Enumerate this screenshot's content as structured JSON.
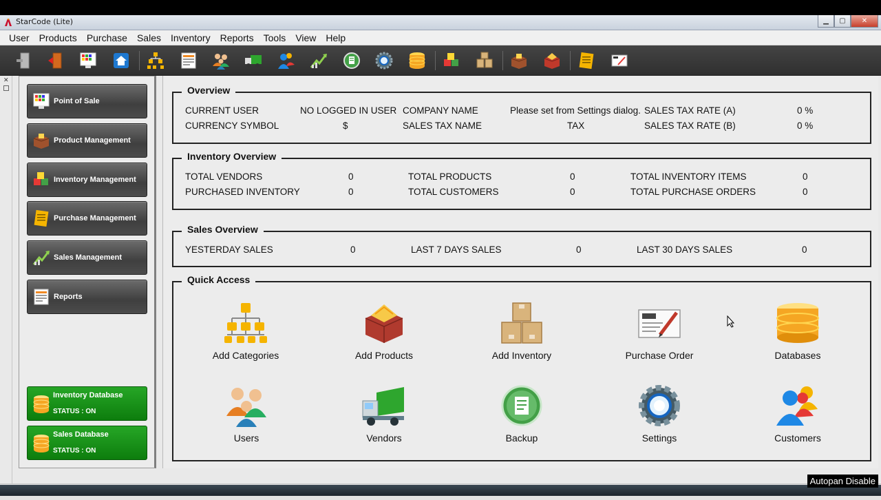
{
  "window": {
    "title": "StarCode (Lite)"
  },
  "menu": [
    "User",
    "Products",
    "Purchase",
    "Sales",
    "Inventory",
    "Reports",
    "Tools",
    "View",
    "Help"
  ],
  "toolbar_icons": [
    "logout-icon",
    "exit-icon",
    "pos-icon",
    "home-icon",
    "categories-icon",
    "reports-icon",
    "users-icon",
    "vendors-icon",
    "customers-icon",
    "sales-icon",
    "backup-icon",
    "settings-icon",
    "database-icon",
    "inventory-icon",
    "add-inventory-icon",
    "product-icon",
    "add-product-icon",
    "purchase-icon",
    "purchase-order-icon"
  ],
  "sidebar": {
    "nav": [
      {
        "label": "Point of Sale",
        "icon": "pos-icon"
      },
      {
        "label": "Product Management",
        "icon": "product-icon"
      },
      {
        "label": "Inventory Management",
        "icon": "inventory-icon"
      },
      {
        "label": "Purchase Management",
        "icon": "purchase-icon"
      },
      {
        "label": "Sales Management",
        "icon": "sales-icon"
      },
      {
        "label": "Reports",
        "icon": "reports-icon"
      }
    ],
    "databases": [
      {
        "label": "Inventory Database",
        "status": "STATUS : ON",
        "color": "#1c9a1c"
      },
      {
        "label": "Sales Database",
        "status": "STATUS : ON",
        "color": "#1c9a1c"
      }
    ]
  },
  "overview": {
    "title": "Overview",
    "current_user_label": "CURRENT USER",
    "current_user_value": "NO LOGGED IN USER",
    "company_label": "COMPANY NAME",
    "company_value": "Please set from Settings dialog.",
    "tax_a_label": "SALES TAX RATE (A)",
    "tax_a_value": "0 %",
    "currency_label": "CURRENCY SYMBOL",
    "currency_value": "$",
    "tax_name_label": "SALES TAX NAME",
    "tax_name_value": "TAX",
    "tax_b_label": "SALES TAX RATE (B)",
    "tax_b_value": "0 %"
  },
  "inventory": {
    "title": "Inventory Overview",
    "vendors_label": "TOTAL VENDORS",
    "vendors_value": "0",
    "products_label": "TOTAL PRODUCTS",
    "products_value": "0",
    "items_label": "TOTAL INVENTORY ITEMS",
    "items_value": "0",
    "purchased_label": "PURCHASED INVENTORY",
    "purchased_value": "0",
    "customers_label": "TOTAL CUSTOMERS",
    "customers_value": "0",
    "po_label": "TOTAL PURCHASE ORDERS",
    "po_value": "0"
  },
  "sales": {
    "title": "Sales Overview",
    "yesterday_label": "YESTERDAY SALES",
    "yesterday_value": "0",
    "last7_label": "LAST 7 DAYS SALES",
    "last7_value": "0",
    "last30_label": "LAST 30 DAYS SALES",
    "last30_value": "0"
  },
  "quick_access": {
    "title": "Quick Access",
    "items": [
      {
        "label": "Add Categories",
        "icon": "categories-icon"
      },
      {
        "label": "Add Products",
        "icon": "add-product-icon"
      },
      {
        "label": "Add Inventory",
        "icon": "add-inventory-icon"
      },
      {
        "label": "Purchase Order",
        "icon": "purchase-order-icon"
      },
      {
        "label": "Databases",
        "icon": "database-icon"
      },
      {
        "label": "Users",
        "icon": "users-icon"
      },
      {
        "label": "Vendors",
        "icon": "vendors-icon"
      },
      {
        "label": "Backup",
        "icon": "backup-icon"
      },
      {
        "label": "Settings",
        "icon": "settings-icon"
      },
      {
        "label": "Customers",
        "icon": "customers-icon"
      }
    ]
  },
  "overlay": {
    "autopan": "Autopan Disable"
  }
}
